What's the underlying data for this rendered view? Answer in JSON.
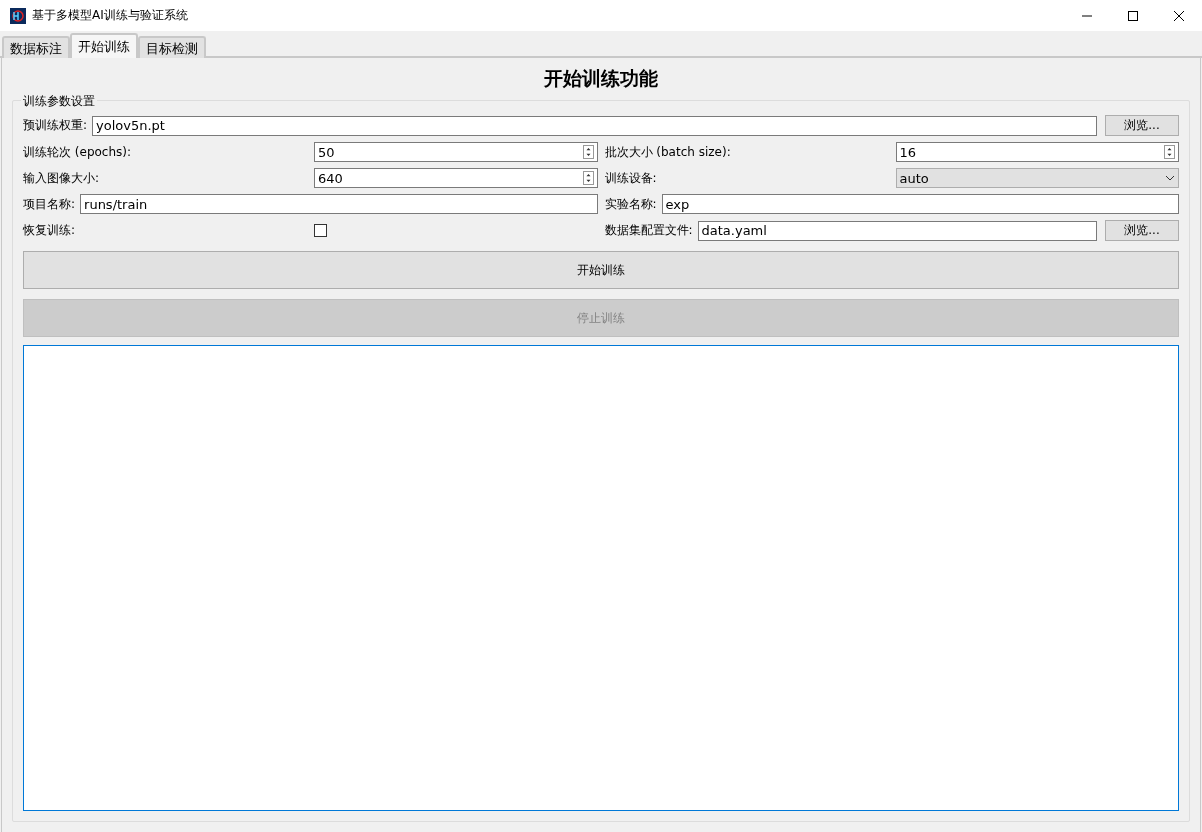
{
  "window": {
    "title": "基于多模型AI训练与验证系统"
  },
  "tabs": [
    {
      "label": "数据标注",
      "selected": false
    },
    {
      "label": "开始训练",
      "selected": true
    },
    {
      "label": "目标检测",
      "selected": false
    }
  ],
  "page_title": "开始训练功能",
  "group": {
    "title": "训练参数设置",
    "rows": [
      [
        {
          "kind": "file",
          "label": "预训练权重:",
          "value": "yolov5n.pt",
          "button": "浏览..."
        }
      ],
      [
        {
          "kind": "spin",
          "label": "训练轮次 (epochs):",
          "value": "50"
        },
        {
          "kind": "spin",
          "label": "批次大小 (batch size):",
          "value": "16"
        }
      ],
      [
        {
          "kind": "spin",
          "label": "输入图像大小:",
          "value": "640"
        },
        {
          "kind": "combo",
          "label": "训练设备:",
          "value": "auto"
        }
      ],
      [
        {
          "kind": "text",
          "label": "项目名称:",
          "value": "runs/train"
        },
        {
          "kind": "text",
          "label": "实验名称:",
          "value": "exp"
        }
      ],
      [
        {
          "kind": "checkbox",
          "label": "恢复训练:",
          "checked": false
        },
        {
          "kind": "file",
          "label": "数据集配置文件:",
          "value": "data.yaml",
          "button": "浏览..."
        }
      ]
    ]
  },
  "buttons": [
    {
      "label": "开始训练",
      "disabled": false
    },
    {
      "label": "停止训练",
      "disabled": true
    }
  ]
}
